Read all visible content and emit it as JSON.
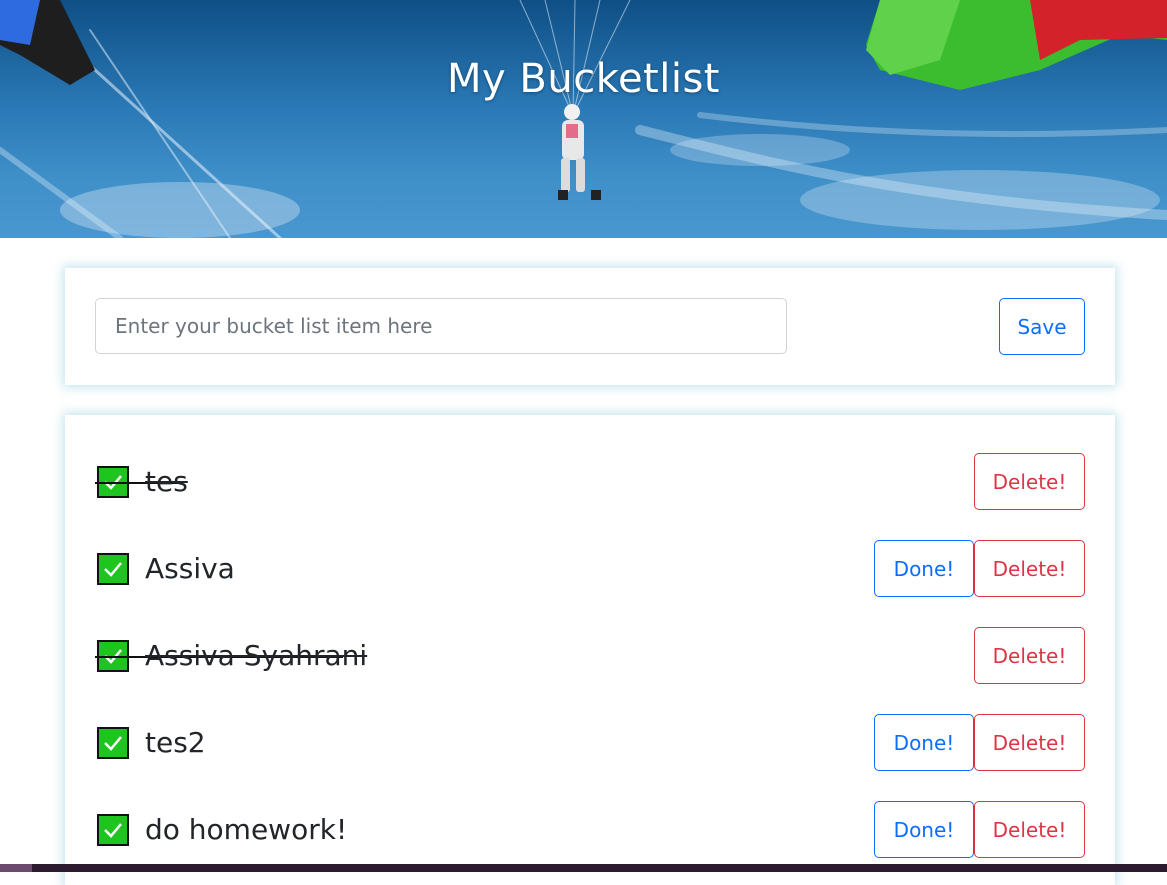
{
  "header": {
    "title": "My Bucketlist"
  },
  "form": {
    "placeholder": "Enter your bucket list item here",
    "value": "",
    "save_label": "Save"
  },
  "list": {
    "done_label": "Done!",
    "delete_label": "Delete!",
    "items": [
      {
        "text": "tes",
        "done": true
      },
      {
        "text": "Assiva",
        "done": false
      },
      {
        "text": "Assiva Syahrani",
        "done": true
      },
      {
        "text": "tes2",
        "done": false
      },
      {
        "text": "do homework!",
        "done": false
      }
    ]
  },
  "colors": {
    "primary": "#0d6efd",
    "danger": "#dc3545",
    "check": "#1ec51e",
    "card_glow": "#78bed7"
  },
  "icons": {
    "check": "checkmark-icon"
  }
}
